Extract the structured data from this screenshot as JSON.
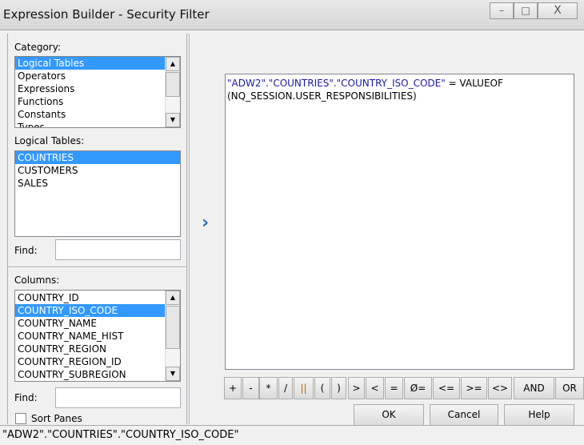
{
  "window": {
    "title": "Expression Builder - Security Filter",
    "minimize": "–",
    "maximize": "□",
    "close": "X"
  },
  "category": {
    "label": "Category:",
    "items": [
      "Logical Tables",
      "Operators",
      "Expressions",
      "Functions",
      "Constants",
      "Types"
    ],
    "selected": 0
  },
  "logical_tables": {
    "label": "Logical Tables:",
    "items": [
      "COUNTRIES",
      "CUSTOMERS",
      "SALES"
    ],
    "selected": 0
  },
  "find1": {
    "label": "Find:",
    "value": ""
  },
  "columns": {
    "label": "Columns:",
    "items": [
      "COUNTRY_ID",
      "COUNTRY_ISO_CODE",
      "COUNTRY_NAME",
      "COUNTRY_NAME_HIST",
      "COUNTRY_REGION",
      "COUNTRY_REGION_ID",
      "COUNTRY_SUBREGION"
    ],
    "selected": 1
  },
  "find2": {
    "label": "Find:",
    "value": ""
  },
  "sort_panes": {
    "label": "Sort Panes",
    "checked": false
  },
  "insert_arrow": "›",
  "editor": {
    "part1": "\"ADW2\".\"COUNTRIES\".\"COUNTRY_ISO_CODE\"",
    "part2": " = VALUEOF",
    "line2": "(NQ_SESSION.USER_RESPONSIBILITIES)",
    "ref_color": "#1a1aa6"
  },
  "operators": [
    "+",
    "-",
    "*",
    "/",
    "||",
    "(",
    ")",
    ">",
    "<",
    "=",
    "Ø=",
    "<=",
    ">=",
    "<>",
    "AND",
    "OR"
  ],
  "buttons": {
    "ok": "OK",
    "cancel": "Cancel",
    "help": "Help"
  },
  "status": "\"ADW2\".\"COUNTRIES\".\"COUNTRY_ISO_CODE\""
}
